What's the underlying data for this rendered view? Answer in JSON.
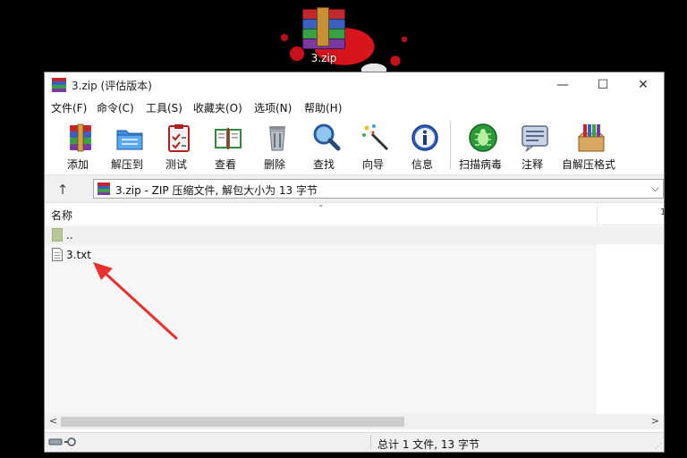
{
  "desktop": {
    "icon_label": "3.zip"
  },
  "window": {
    "title": "3.zip (评估版本)",
    "controls": {
      "minimize": "—",
      "maximize": "☐",
      "close": "✕"
    }
  },
  "menu": [
    "文件(F)",
    "命令(C)",
    "工具(S)",
    "收藏夹(O)",
    "选项(N)",
    "帮助(H)"
  ],
  "toolbar": [
    {
      "label": "添加",
      "icon": "add-archive-icon"
    },
    {
      "label": "解压到",
      "icon": "extract-to-icon"
    },
    {
      "label": "测试",
      "icon": "test-icon"
    },
    {
      "label": "查看",
      "icon": "view-icon"
    },
    {
      "label": "删除",
      "icon": "delete-icon"
    },
    {
      "label": "查找",
      "icon": "find-icon"
    },
    {
      "label": "向导",
      "icon": "wizard-icon"
    },
    {
      "label": "信息",
      "icon": "info-icon"
    },
    {
      "label": "扫描病毒",
      "icon": "virus-scan-icon"
    },
    {
      "label": "注释",
      "icon": "comment-icon"
    },
    {
      "label": "自解压格式",
      "icon": "sfx-icon"
    }
  ],
  "address": {
    "text": "3.zip - ZIP 压缩文件, 解包大小为 13 字节"
  },
  "columns": {
    "name": "名称",
    "next": "1"
  },
  "files": [
    {
      "name": "..",
      "type": "parent-folder"
    },
    {
      "name": "3.txt",
      "type": "text-file"
    }
  ],
  "status": {
    "summary": "总计 1 文件, 13 字节"
  },
  "colors": {
    "annotation_arrow": "#e8312f",
    "desktop_splash": "#d8141c"
  }
}
